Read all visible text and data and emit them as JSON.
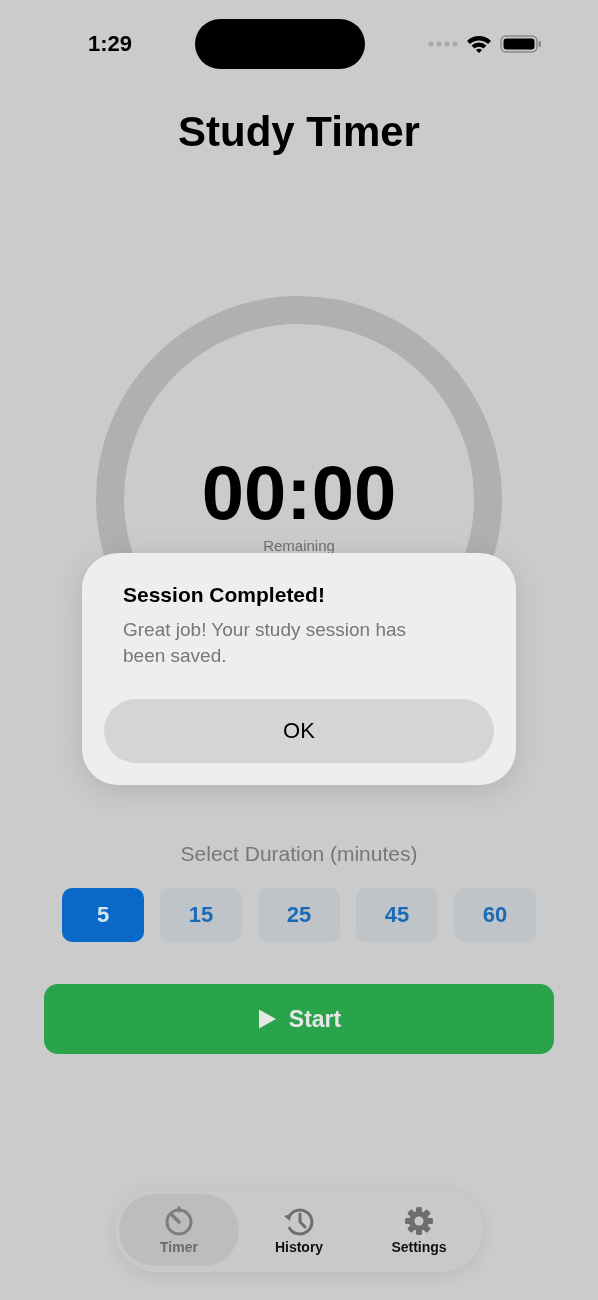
{
  "status_bar": {
    "time": "1:29"
  },
  "title": "Study Timer",
  "timer": {
    "time": "00:00",
    "caption": "Remaining"
  },
  "duration": {
    "label": "Select Duration (minutes)",
    "options": [
      {
        "label": "5",
        "selected": true
      },
      {
        "label": "15",
        "selected": false
      },
      {
        "label": "25",
        "selected": false
      },
      {
        "label": "45",
        "selected": false
      },
      {
        "label": "60",
        "selected": false
      }
    ]
  },
  "start_button": {
    "label": "Start"
  },
  "tab_bar": [
    {
      "label": "Timer",
      "selected": true
    },
    {
      "label": "History",
      "selected": false
    },
    {
      "label": "Settings",
      "selected": false
    }
  ],
  "alert": {
    "title": "Session Completed!",
    "message": "Great job! Your study session has been saved.",
    "button": "OK"
  }
}
